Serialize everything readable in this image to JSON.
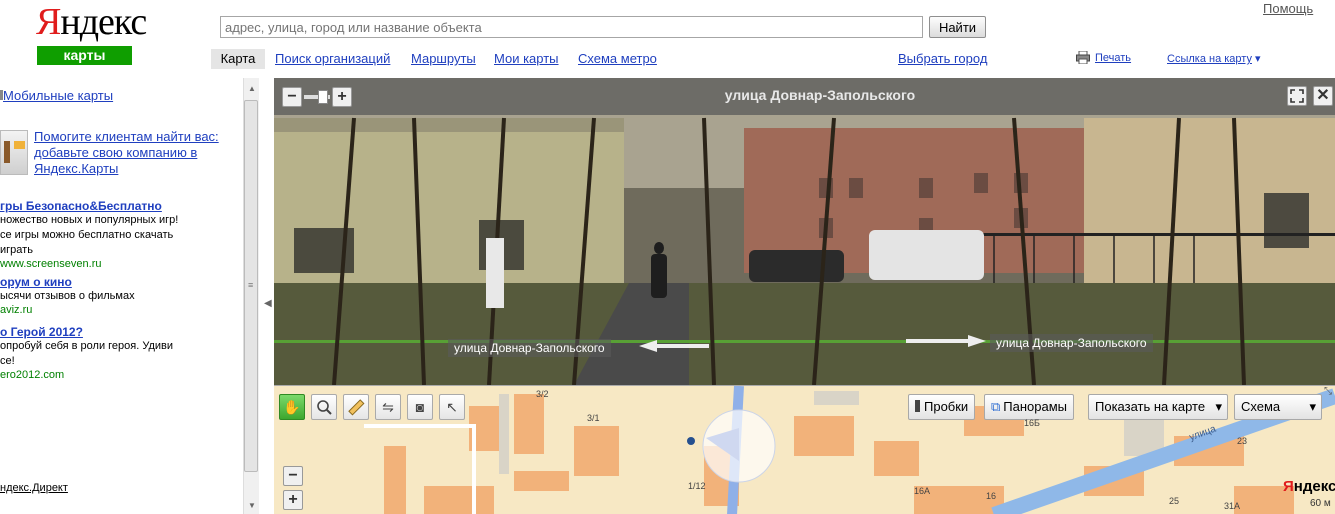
{
  "header": {
    "logo_first_letter": "Я",
    "logo_rest": "ндекс",
    "logo_badge": "карты",
    "search_placeholder": "адрес, улица, город или название объекта",
    "search_button": "Найти",
    "help_link": "Помощь",
    "nav": {
      "active_tab": "Карта",
      "tabs": [
        "Поиск организаций",
        "Маршруты",
        "Мои карты",
        "Схема метро"
      ],
      "choose_city": "Выбрать город"
    },
    "print_label": "Печать",
    "map_link": "Ссылка на карту",
    "map_link_arrow": "▾"
  },
  "sidebar": {
    "mobile_maps": "Мобильные карты",
    "promo_text": "Помогите клиентам найти вас: добавьте свою компанию в Яндекс.Карты",
    "ads": [
      {
        "title": "гры Безопасно&Бесплатно",
        "text": "ножество новых и популярных игр! се игры можно бесплатно скачать играть",
        "url": "www.screenseven.ru"
      },
      {
        "title": "орум о кино",
        "text": "ысячи отзывов о фильмах",
        "url": "aviz.ru"
      },
      {
        "title": "о Герой 2012?",
        "text": "опробуй себя в роли героя. Удиви се!",
        "url": "ero2012.com"
      }
    ],
    "direct_label": "ндекс.Директ"
  },
  "panorama": {
    "title": "улица Довнар-Запольского",
    "street_left": "улица Довнар-Запольского",
    "street_right": "улица Довнар-Запольского",
    "zoom_minus": "−",
    "zoom_plus": "+",
    "close_symbol": "✕"
  },
  "map": {
    "traffic_label": "Пробки",
    "panoramas_label": "Панорамы",
    "show_on_map": "Показать на карте",
    "layer_select": "Схема",
    "dropdown_arrow": "▾",
    "zoom_minus": "−",
    "zoom_plus": "+",
    "houses": [
      "3/2",
      "3/1",
      "1/12",
      "16Б",
      "16А",
      "16",
      "23",
      "25",
      "31А"
    ],
    "street_name": "улица",
    "watermark": "Яндекс",
    "scale": "60 м"
  }
}
